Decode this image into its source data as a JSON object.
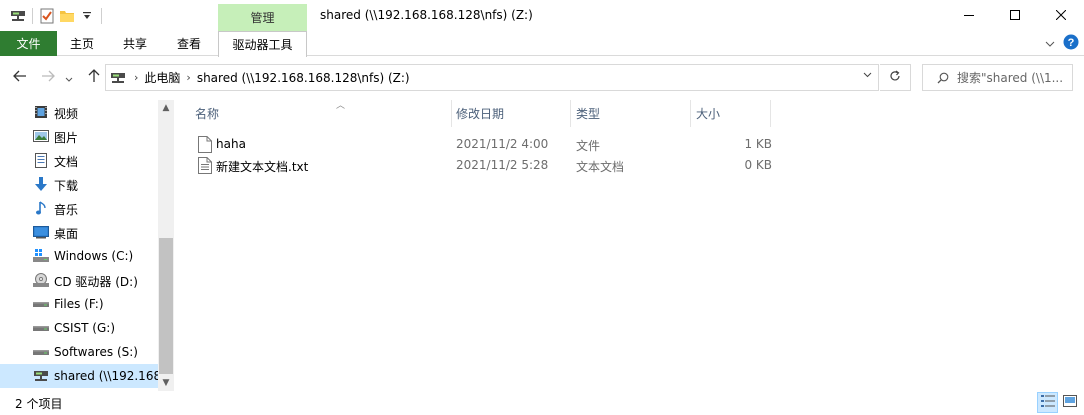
{
  "window": {
    "title": "shared (\\\\192.168.168.128\\nfs) (Z:)",
    "context_tab_group": "管理"
  },
  "ribbon": {
    "tabs": [
      {
        "label": "文件"
      },
      {
        "label": "主页"
      },
      {
        "label": "共享"
      },
      {
        "label": "查看"
      },
      {
        "label": "驱动器工具"
      }
    ]
  },
  "address": {
    "breadcrumb": [
      "此电脑",
      "shared (\\\\192.168.168.128\\nfs) (Z:)"
    ],
    "search_placeholder": "搜索\"shared (\\\\1..."
  },
  "sidebar": {
    "items": [
      {
        "label": "视频",
        "icon": "video-icon"
      },
      {
        "label": "图片",
        "icon": "pictures-icon"
      },
      {
        "label": "文档",
        "icon": "documents-icon"
      },
      {
        "label": "下载",
        "icon": "download-icon"
      },
      {
        "label": "音乐",
        "icon": "music-icon"
      },
      {
        "label": "桌面",
        "icon": "desktop-icon"
      },
      {
        "label": "Windows (C:)",
        "icon": "windows-drive-icon"
      },
      {
        "label": "CD 驱动器 (D:)",
        "icon": "cd-drive-icon"
      },
      {
        "label": "Files (F:)",
        "icon": "drive-icon"
      },
      {
        "label": "CSIST (G:)",
        "icon": "drive-icon"
      },
      {
        "label": "Softwares (S:)",
        "icon": "drive-icon"
      },
      {
        "label": "shared (\\\\192.168",
        "icon": "network-drive-icon",
        "selected": true
      }
    ]
  },
  "filelist": {
    "columns": {
      "name": "名称",
      "date": "修改日期",
      "type": "类型",
      "size": "大小"
    },
    "rows": [
      {
        "name": "haha",
        "date": "2021/11/2 4:00",
        "type": "文件",
        "size": "1 KB"
      },
      {
        "name": "新建文本文档.txt",
        "date": "2021/11/2 5:28",
        "type": "文本文档",
        "size": "0 KB"
      }
    ]
  },
  "status": {
    "item_count": "2 个项目"
  },
  "colors": {
    "file_tab": "#2f7d31",
    "context_tab": "#c6efb9",
    "selection": "#cce8ff"
  }
}
